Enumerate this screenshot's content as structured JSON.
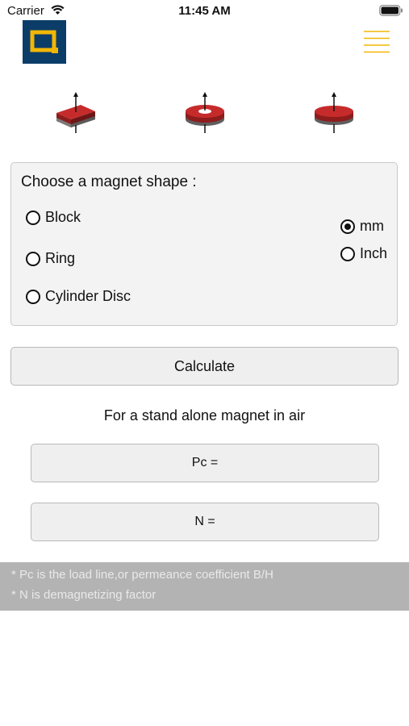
{
  "status_bar": {
    "carrier": "Carrier",
    "time": "11:45 AM",
    "wifi_icon": "wifi-icon",
    "battery_icon": "battery-icon"
  },
  "header": {
    "logo_icon": "logo-icon",
    "menu_icon": "hamburger-menu-icon",
    "logo_colors": {
      "background": "#0c3d69",
      "accent": "#f2b705"
    },
    "menu_color": "#f2b705"
  },
  "shapes": [
    {
      "name": "block-magnet-image",
      "color": "#b32222"
    },
    {
      "name": "ring-magnet-image",
      "color": "#b32222"
    },
    {
      "name": "cylinder-disc-magnet-image",
      "color": "#b32222"
    }
  ],
  "form": {
    "title": "Choose a magnet shape :",
    "shape_options": [
      {
        "label": "Block",
        "checked": false
      },
      {
        "label": "Ring",
        "checked": false
      },
      {
        "label": "Cylinder Disc",
        "checked": false
      }
    ],
    "unit_options": [
      {
        "label": "mm",
        "checked": true
      },
      {
        "label": "Inch",
        "checked": false
      }
    ]
  },
  "calculate_button": "Calculate",
  "subtitle": "For a stand alone magnet in air",
  "results": {
    "pc_label": "Pc =",
    "n_label": "N ="
  },
  "notes": [
    "* Pc is the load line,or permeance coefficient B/H",
    "* N is demagnetizing factor"
  ]
}
